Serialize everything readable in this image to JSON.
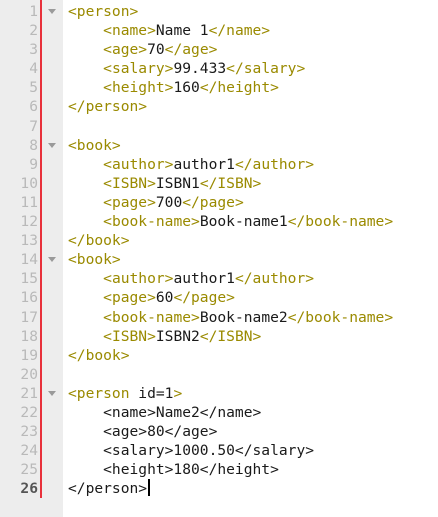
{
  "editor": {
    "current_line": 26,
    "fold_lines": [
      1,
      8,
      14,
      21
    ],
    "lines": [
      {
        "n": "1",
        "tokens": [
          {
            "t": "tag",
            "v": "<person>"
          }
        ]
      },
      {
        "n": "2",
        "tokens": [
          {
            "t": "txt",
            "v": "    "
          },
          {
            "t": "tag",
            "v": "<name>"
          },
          {
            "t": "txt",
            "v": "Name 1"
          },
          {
            "t": "tag",
            "v": "</name>"
          }
        ]
      },
      {
        "n": "3",
        "tokens": [
          {
            "t": "txt",
            "v": "    "
          },
          {
            "t": "tag",
            "v": "<age>"
          },
          {
            "t": "txt",
            "v": "70"
          },
          {
            "t": "tag",
            "v": "</age>"
          }
        ]
      },
      {
        "n": "4",
        "tokens": [
          {
            "t": "txt",
            "v": "    "
          },
          {
            "t": "tag",
            "v": "<salary>"
          },
          {
            "t": "txt",
            "v": "99.433"
          },
          {
            "t": "tag",
            "v": "</salary>"
          }
        ]
      },
      {
        "n": "5",
        "tokens": [
          {
            "t": "txt",
            "v": "    "
          },
          {
            "t": "tag",
            "v": "<height>"
          },
          {
            "t": "txt",
            "v": "160"
          },
          {
            "t": "tag",
            "v": "</height>"
          }
        ]
      },
      {
        "n": "6",
        "tokens": [
          {
            "t": "tag",
            "v": "</person>"
          }
        ]
      },
      {
        "n": "7",
        "tokens": []
      },
      {
        "n": "8",
        "tokens": [
          {
            "t": "tag",
            "v": "<book>"
          }
        ]
      },
      {
        "n": "9",
        "tokens": [
          {
            "t": "txt",
            "v": "    "
          },
          {
            "t": "tag",
            "v": "<author>"
          },
          {
            "t": "txt",
            "v": "author1"
          },
          {
            "t": "tag",
            "v": "</author>"
          }
        ]
      },
      {
        "n": "10",
        "tokens": [
          {
            "t": "txt",
            "v": "    "
          },
          {
            "t": "tag",
            "v": "<ISBN>"
          },
          {
            "t": "txt",
            "v": "ISBN1"
          },
          {
            "t": "tag",
            "v": "</ISBN>"
          }
        ]
      },
      {
        "n": "11",
        "tokens": [
          {
            "t": "txt",
            "v": "    "
          },
          {
            "t": "tag",
            "v": "<page>"
          },
          {
            "t": "txt",
            "v": "700"
          },
          {
            "t": "tag",
            "v": "</page>"
          }
        ]
      },
      {
        "n": "12",
        "tokens": [
          {
            "t": "txt",
            "v": "    "
          },
          {
            "t": "tag",
            "v": "<book-name>"
          },
          {
            "t": "txt",
            "v": "Book-name1"
          },
          {
            "t": "tag",
            "v": "</book-name>"
          }
        ]
      },
      {
        "n": "13",
        "tokens": [
          {
            "t": "tag",
            "v": "</book>"
          }
        ]
      },
      {
        "n": "14",
        "tokens": [
          {
            "t": "tag",
            "v": "<book>"
          }
        ]
      },
      {
        "n": "15",
        "tokens": [
          {
            "t": "txt",
            "v": "    "
          },
          {
            "t": "tag",
            "v": "<author>"
          },
          {
            "t": "txt",
            "v": "author1"
          },
          {
            "t": "tag",
            "v": "</author>"
          }
        ]
      },
      {
        "n": "16",
        "tokens": [
          {
            "t": "txt",
            "v": "    "
          },
          {
            "t": "tag",
            "v": "<page>"
          },
          {
            "t": "txt",
            "v": "60"
          },
          {
            "t": "tag",
            "v": "</page>"
          }
        ]
      },
      {
        "n": "17",
        "tokens": [
          {
            "t": "txt",
            "v": "    "
          },
          {
            "t": "tag",
            "v": "<book-name>"
          },
          {
            "t": "txt",
            "v": "Book-name2"
          },
          {
            "t": "tag",
            "v": "</book-name>"
          }
        ]
      },
      {
        "n": "18",
        "tokens": [
          {
            "t": "txt",
            "v": "    "
          },
          {
            "t": "tag",
            "v": "<ISBN>"
          },
          {
            "t": "txt",
            "v": "ISBN2"
          },
          {
            "t": "tag",
            "v": "</ISBN>"
          }
        ]
      },
      {
        "n": "19",
        "tokens": [
          {
            "t": "tag",
            "v": "</book>"
          }
        ]
      },
      {
        "n": "20",
        "tokens": []
      },
      {
        "n": "21",
        "tokens": [
          {
            "t": "tag",
            "v": "<person "
          },
          {
            "t": "txt",
            "v": "id=1"
          },
          {
            "t": "tag",
            "v": ">"
          }
        ]
      },
      {
        "n": "22",
        "tokens": [
          {
            "t": "txt",
            "v": "    <name>Name2</name>"
          }
        ]
      },
      {
        "n": "23",
        "tokens": [
          {
            "t": "txt",
            "v": "    <age>80</age>"
          }
        ]
      },
      {
        "n": "24",
        "tokens": [
          {
            "t": "txt",
            "v": "    <salary>1000.50</salary>"
          }
        ]
      },
      {
        "n": "25",
        "tokens": [
          {
            "t": "txt",
            "v": "    <height>180</height>"
          }
        ]
      },
      {
        "n": "26",
        "tokens": [
          {
            "t": "txt",
            "v": "</person>"
          }
        ]
      }
    ],
    "colors": {
      "gutter_bg": "#ededed",
      "gutter_marker": "#e8313b",
      "tag": "#9a8a00",
      "text": "#1a1a1a",
      "line_number": "#b9b9b9"
    }
  }
}
